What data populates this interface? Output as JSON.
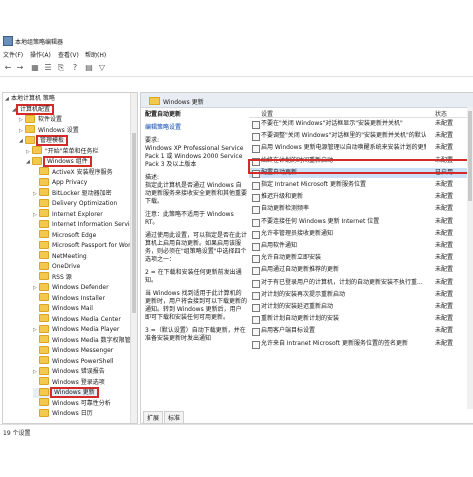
{
  "window": {
    "title": "本地组策略编辑器"
  },
  "menu": [
    "文件(F)",
    "操作(A)",
    "查看(V)",
    "帮助(H)"
  ],
  "tree": [
    {
      "label": "本地计算机 策略",
      "indent": 0,
      "arrow": "◢",
      "folder": false
    },
    {
      "label": "计算机配置",
      "indent": 1,
      "arrow": "◢",
      "folder": false,
      "highlight": true
    },
    {
      "label": "软件设置",
      "indent": 2,
      "arrow": "▷",
      "folder": true
    },
    {
      "label": "Windows 设置",
      "indent": 2,
      "arrow": "▷",
      "folder": true
    },
    {
      "label": "管理模板",
      "indent": 2,
      "arrow": "◢",
      "folder": true,
      "highlight": true
    },
    {
      "label": "\"开始\"菜单和任务栏",
      "indent": 3,
      "arrow": "▷",
      "folder": true
    },
    {
      "label": "Windows 组件",
      "indent": 3,
      "arrow": "◢",
      "folder": true,
      "highlight": true
    },
    {
      "label": "ActiveX 安装程序服务",
      "indent": 4,
      "arrow": "",
      "folder": true
    },
    {
      "label": "App Privacy",
      "indent": 4,
      "arrow": "",
      "folder": true
    },
    {
      "label": "BitLocker 驱动器加密",
      "indent": 4,
      "arrow": "▷",
      "folder": true
    },
    {
      "label": "Delivery Optimization",
      "indent": 4,
      "arrow": "",
      "folder": true
    },
    {
      "label": "Internet Explorer",
      "indent": 4,
      "arrow": "▷",
      "folder": true
    },
    {
      "label": "Internet Information Service",
      "indent": 4,
      "arrow": "",
      "folder": true
    },
    {
      "label": "Microsoft Edge",
      "indent": 4,
      "arrow": "",
      "folder": true
    },
    {
      "label": "Microsoft Passport for Wor",
      "indent": 4,
      "arrow": "",
      "folder": true
    },
    {
      "label": "NetMeeting",
      "indent": 4,
      "arrow": "",
      "folder": true
    },
    {
      "label": "OneDrive",
      "indent": 4,
      "arrow": "",
      "folder": true
    },
    {
      "label": "RSS 源",
      "indent": 4,
      "arrow": "",
      "folder": true
    },
    {
      "label": "Windows Defender",
      "indent": 4,
      "arrow": "▷",
      "folder": true
    },
    {
      "label": "Windows Installer",
      "indent": 4,
      "arrow": "",
      "folder": true
    },
    {
      "label": "Windows Mail",
      "indent": 4,
      "arrow": "",
      "folder": true
    },
    {
      "label": "Windows Media Center",
      "indent": 4,
      "arrow": "",
      "folder": true
    },
    {
      "label": "Windows Media Player",
      "indent": 4,
      "arrow": "▷",
      "folder": true
    },
    {
      "label": "Windows Media 数字权限管理",
      "indent": 4,
      "arrow": "",
      "folder": true
    },
    {
      "label": "Windows Messenger",
      "indent": 4,
      "arrow": "",
      "folder": true
    },
    {
      "label": "Windows PowerShell",
      "indent": 4,
      "arrow": "",
      "folder": true
    },
    {
      "label": "Windows 错误报告",
      "indent": 4,
      "arrow": "▷",
      "folder": true
    },
    {
      "label": "Windows 登录选项",
      "indent": 4,
      "arrow": "",
      "folder": true
    },
    {
      "label": "Windows 更新",
      "indent": 4,
      "arrow": "",
      "folder": true,
      "highlight": true,
      "selected": true
    },
    {
      "label": "Windows 可靠性分析",
      "indent": 4,
      "arrow": "",
      "folder": true
    },
    {
      "label": "Windows 日历",
      "indent": 4,
      "arrow": "",
      "folder": true
    }
  ],
  "right_header": "Windows 更新",
  "description": {
    "policy_title": "配置自动更新",
    "edit_link": "编辑策略设置",
    "req_label": "要求:",
    "req_text": "Windows XP Professional Service Pack 1 或 Windows 2000 Service Pack 3 及以上版本",
    "desc_label": "描述:",
    "desc_text": "指定此计算机是否通过 Windows 自动更新服务来接收安全更新和其他重要下载。",
    "note_text": "注意：此策略不适用于 Windows RT。",
    "body_text": "通过使用此设置，可以指定是否在此计算机上启用自动更新。如果启用该服务，则必须在\"组策略设置\"中选择四个选项之一：",
    "opt2": "2 = 在下载和安装任何更新前发出通知。",
    "opt2_more": "当 Windows 找到适用于此计算机的更新时，用户将会接到可以下载更新的通知。转到 Windows 更新后，用户即可下载和安装任何可用更新。",
    "opt3": "3 =（默认设置）自动下载更新，并在准备安装更新时发出通知"
  },
  "columns": {
    "setting": "设置",
    "state": "状态"
  },
  "settings": [
    {
      "name": "不要在\"关闭 Windows\"对话框显示\"安装更新并关机\"",
      "state": "未配置"
    },
    {
      "name": "不要调整\"关闭 Windows\"对话框里的\"安装更新并关机\"的默认...",
      "state": "未配置"
    },
    {
      "name": "启用 Windows 更新电源管理以自动唤醒系统来安装计划的更新",
      "state": "未配置"
    },
    {
      "name": "始终在计划的时间重新启动",
      "state": "未配置"
    },
    {
      "name": "配置自动更新",
      "state": "已启用",
      "selected": true
    },
    {
      "name": "指定 Intranet Microsoft 更新服务位置",
      "state": "未配置"
    },
    {
      "name": "推迟升级和更新",
      "state": "未配置"
    },
    {
      "name": "自动更新检测频率",
      "state": "未配置"
    },
    {
      "name": "不要连接任何 Windows 更新 Internet 位置",
      "state": "未配置"
    },
    {
      "name": "允许非管理员接收更新通知",
      "state": "未配置"
    },
    {
      "name": "启用软件通知",
      "state": "未配置"
    },
    {
      "name": "允许自动更新立即安装",
      "state": "未配置"
    },
    {
      "name": "启用通过自动更新推荐的更新",
      "state": "未配置"
    },
    {
      "name": "对于有已登录用户的计算机，计划的自动更新安装不执行重...",
      "state": "未配置"
    },
    {
      "name": "对计划的安装再次提示重新启动",
      "state": "未配置"
    },
    {
      "name": "对计划的安装延迟重新启动",
      "state": "未配置"
    },
    {
      "name": "重新计划自动更新计划的安装",
      "state": "未配置"
    },
    {
      "name": "启用客户端目标设置",
      "state": "未配置"
    },
    {
      "name": "允许来自 Intranet Microsoft 更新服务位置的签名更新",
      "state": "未配置"
    }
  ],
  "tabs": [
    "扩展",
    "标准"
  ],
  "status": "19 个设置"
}
